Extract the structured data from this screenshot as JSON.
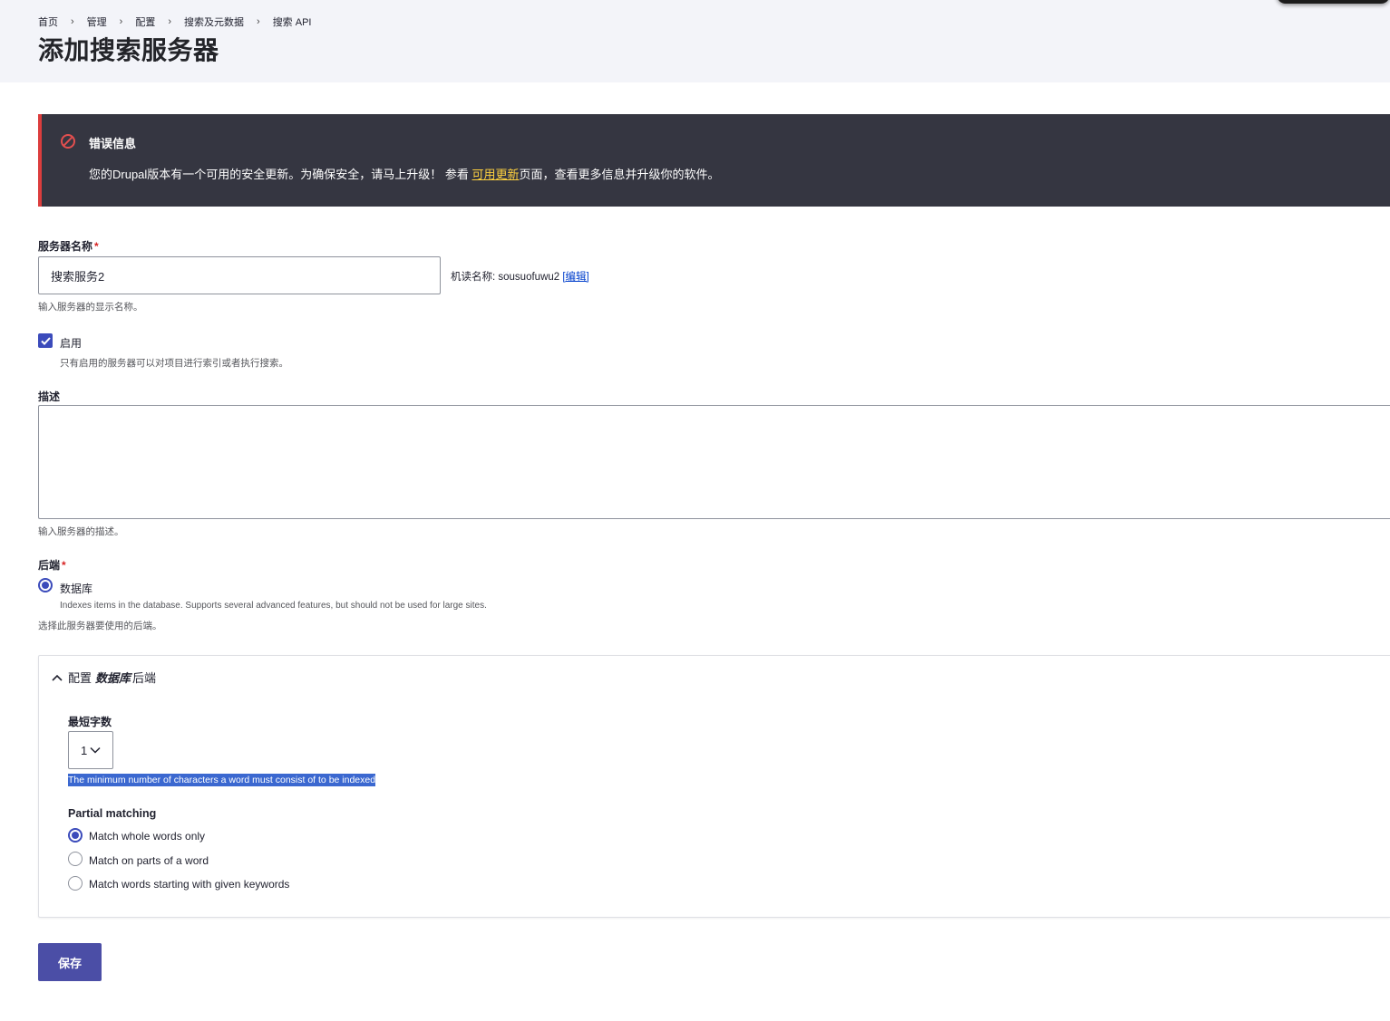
{
  "header": {
    "breadcrumb": [
      "首页",
      "管理",
      "配置",
      "搜索及元数据",
      "搜索 API"
    ],
    "title": "添加搜索服务器"
  },
  "messages": {
    "title": "错误信息",
    "text_before": "您的Drupal版本有一个可用的安全更新。为确保安全，请马上升级！ 参看 ",
    "link": "可用更新",
    "text_after": "页面，查看更多信息并升级你的软件。",
    "icon": "error-icon",
    "accent_color": "#dc3d3d"
  },
  "form": {
    "server_name": {
      "label": "服务器名称",
      "required_mark": "*",
      "value": "搜索服务2",
      "machine_name_prefix": "机读名称: sousuofuwu2 ",
      "machine_name_edit": "[编辑]",
      "description": "输入服务器的显示名称。"
    },
    "enabled": {
      "label": "启用",
      "checked": true,
      "description": "只有启用的服务器可以对项目进行索引或者执行搜索。"
    },
    "description": {
      "label": "描述",
      "value": "",
      "help": "输入服务器的描述。"
    },
    "backend": {
      "label": "后端",
      "required_mark": "*",
      "option_label": "数据库",
      "option_description": "Indexes items in the database. Supports several advanced features, but should not be used for large sites.",
      "help": "选择此服务器要使用的后端。"
    },
    "backend_config": {
      "summary_prefix": "配置",
      "summary_em": "数据库",
      "summary_suffix": "后端",
      "expanded": true,
      "min_chars": {
        "label": "最短字数",
        "value": "1",
        "help": "The minimum number of characters a word must consist of to be indexed"
      },
      "partial_matching": {
        "label": "Partial matching",
        "options": [
          "Match whole words only",
          "Match on parts of a word",
          "Match words starting with given keywords"
        ],
        "selected": 0
      }
    },
    "save_label": "保存"
  },
  "colors": {
    "accent": "#3b4bbb",
    "button": "#4b4ea6",
    "message_bg": "#353641",
    "link_highlight": "#ffd23f"
  }
}
